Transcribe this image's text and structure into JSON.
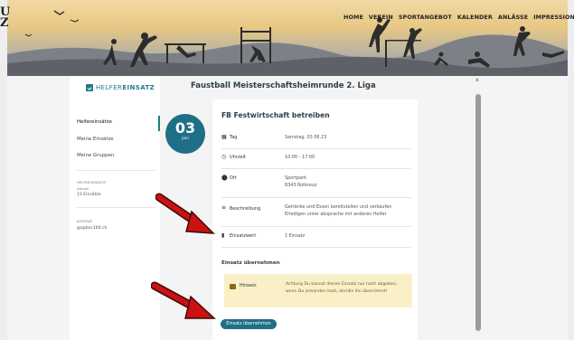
{
  "header": {
    "corner_logo": "U\nZ",
    "nav": [
      "HOME",
      "VEREIN",
      "SPORTANGEBOT",
      "KALENDER",
      "ANLÄSSE",
      "IMPRESSIONEN"
    ]
  },
  "sidebar": {
    "brand_light": "HELFER",
    "brand_bold": "EINSATZ",
    "items": [
      "Helfereinsätze",
      "Meine Einsätze",
      "Meine Gruppen"
    ],
    "info_label_1": "HELFER-EINSATZ",
    "info_label_2": "Aktuell",
    "info_value": "13 Einsätze",
    "contact_label": "KONTAKT",
    "contact_value": "gs@bsc100.ch"
  },
  "main": {
    "page_title": "Faustball Meisterschaftsheimrunde 2. Liga",
    "date_day": "03",
    "date_month": "Juni",
    "card_title": "FB Festwirtschaft betreiben",
    "rows": [
      {
        "icon": "calendar-icon",
        "label": "Tag",
        "value": "Samstag, 03.06.23"
      },
      {
        "icon": "clock-icon",
        "label": "Uhrzeit",
        "value": "10:00 - 17:00"
      },
      {
        "icon": "location-icon",
        "label": "Ort",
        "value": "Sportpark\n8343 Rotkreuz"
      },
      {
        "icon": "list-icon",
        "label": "Beschreibung",
        "value": "Getränke und Essen bereitstellen und verkaufen\nErledigen unter absprache mit anderen Helfer"
      },
      {
        "icon": "bar-chart-icon",
        "label": "Einsatzwert",
        "value": "1 Einsatz"
      }
    ],
    "section_title": "Einsatz übernehmen",
    "notice_label": "Hinweis",
    "notice_text": "Achtung Du kannst diesen Einsatz nur noch abgeben, wenn Du jemanden hast, der/die ihn übernimmt!",
    "accept_button": "Einsatz übernehmen"
  },
  "colors": {
    "accent": "#1f6f86",
    "notice_bg": "#faf0c7",
    "arrow": "#cc1111"
  }
}
